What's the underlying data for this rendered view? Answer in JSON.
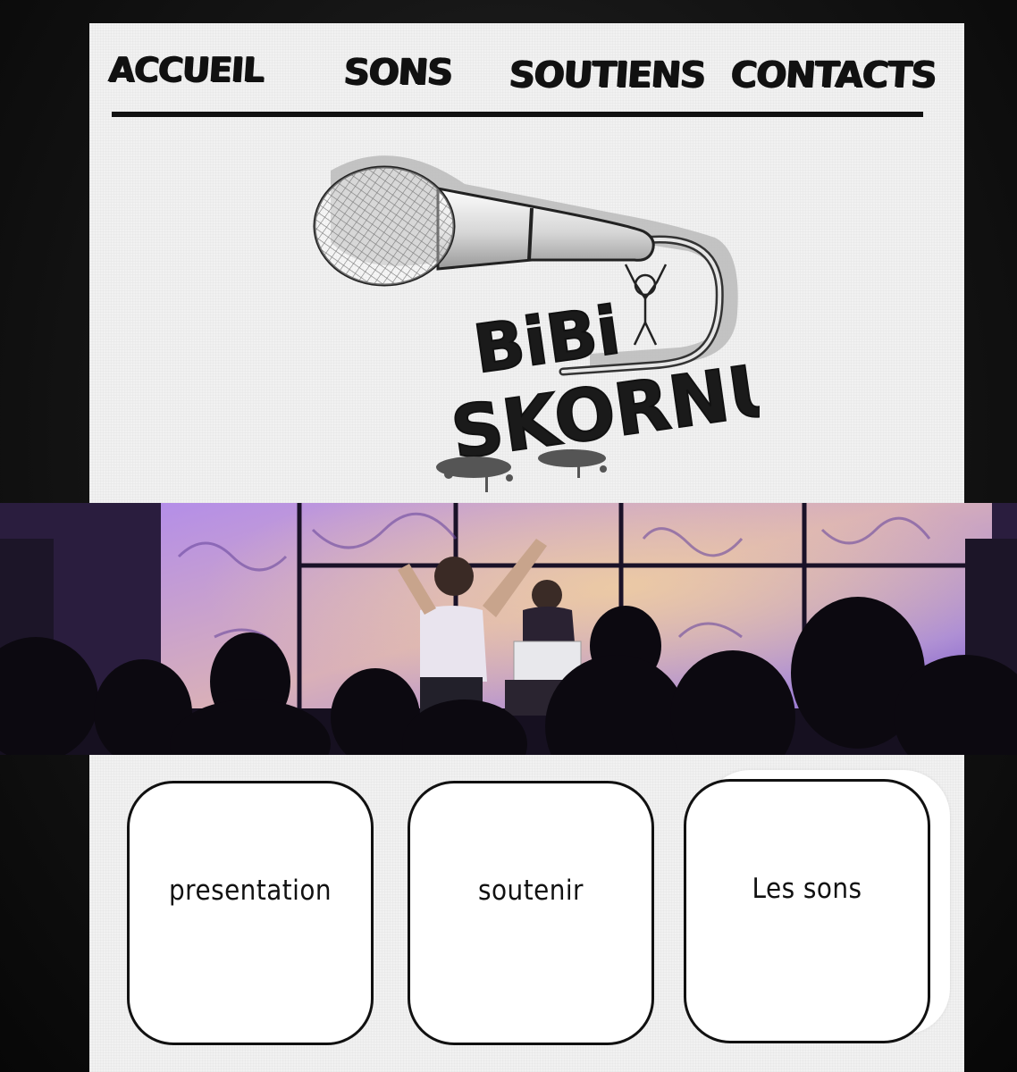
{
  "nav": {
    "items": [
      {
        "label": "ACCUEIL"
      },
      {
        "label": "SONS"
      },
      {
        "label": "SOUTIENS"
      },
      {
        "label": "CONTACTS"
      }
    ]
  },
  "logo": {
    "line1": "BiBi",
    "line2": "SKORNU"
  },
  "cards": [
    {
      "label": "presentation"
    },
    {
      "label": "soutenir"
    },
    {
      "label": "Les sons"
    }
  ],
  "colors": {
    "panel": "#f1f1f1",
    "ink": "#111111",
    "background": "#141414",
    "stage_purple": "#7a4fc9"
  }
}
